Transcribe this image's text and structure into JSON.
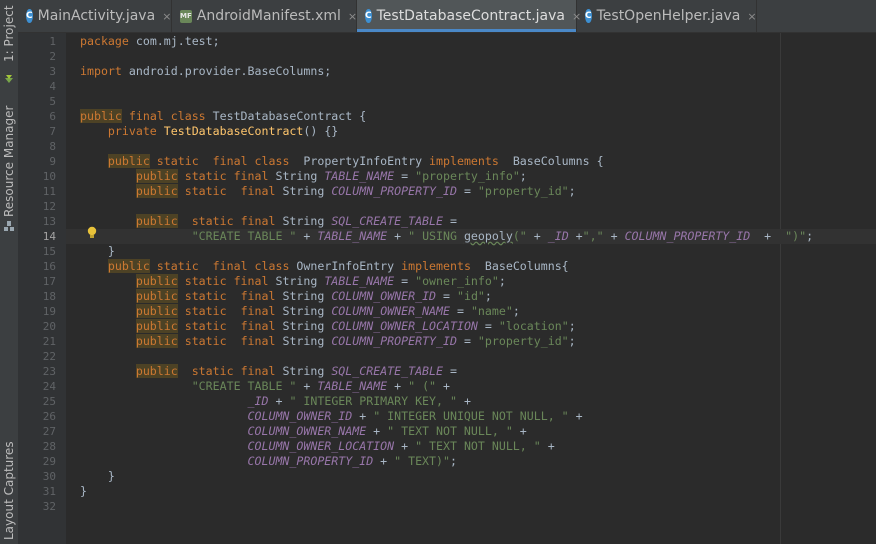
{
  "sidebar": {
    "project_label": "1: Project",
    "resource_label": "Resource Manager",
    "captures_label": "Layout Captures"
  },
  "tabs": [
    {
      "label": "MainActivity.java",
      "icon": "C",
      "type": "java",
      "active": false
    },
    {
      "label": "AndroidManifest.xml",
      "icon": "MF",
      "type": "xml",
      "active": false
    },
    {
      "label": "TestDatabaseContract.java",
      "icon": "C",
      "type": "java",
      "active": true
    },
    {
      "label": "TestOpenHelper.java",
      "icon": "C",
      "type": "java",
      "active": false
    }
  ],
  "close_glyph": "×",
  "editor": {
    "current_line": 14,
    "lines": [
      [
        [
          "kw",
          "package"
        ],
        [
          "p",
          " com.mj.test;"
        ]
      ],
      [],
      [
        [
          "kw",
          "import"
        ],
        [
          "p",
          " android.provider.BaseColumns;"
        ]
      ],
      [],
      [],
      [
        [
          "pub",
          "public"
        ],
        [
          "p",
          " "
        ],
        [
          "kw",
          "final class"
        ],
        [
          "p",
          " TestDatabaseContract {"
        ]
      ],
      [
        [
          "p",
          "    "
        ],
        [
          "kw",
          "private"
        ],
        [
          "p",
          " "
        ],
        [
          "fn",
          "TestDatabaseContract"
        ],
        [
          "p",
          "() {}"
        ]
      ],
      [],
      [
        [
          "p",
          "    "
        ],
        [
          "pub",
          "public"
        ],
        [
          "p",
          " "
        ],
        [
          "kw",
          "static"
        ],
        [
          "p",
          "  "
        ],
        [
          "kw",
          "final class"
        ],
        [
          "p",
          "  PropertyInfoEntry "
        ],
        [
          "kw",
          "implements"
        ],
        [
          "p",
          "  BaseColumns {"
        ]
      ],
      [
        [
          "p",
          "        "
        ],
        [
          "pub",
          "public"
        ],
        [
          "p",
          " "
        ],
        [
          "kw",
          "static final"
        ],
        [
          "p",
          " String "
        ],
        [
          "cst",
          "TABLE_NAME"
        ],
        [
          "p",
          " = "
        ],
        [
          "str",
          "\"property_info\""
        ],
        [
          "p",
          ";"
        ]
      ],
      [
        [
          "p",
          "        "
        ],
        [
          "pub",
          "public"
        ],
        [
          "p",
          " "
        ],
        [
          "kw",
          "static"
        ],
        [
          "p",
          "  "
        ],
        [
          "kw",
          "final"
        ],
        [
          "p",
          " String "
        ],
        [
          "cst",
          "COLUMN_PROPERTY_ID"
        ],
        [
          "p",
          " = "
        ],
        [
          "str",
          "\"property_id\""
        ],
        [
          "p",
          ";"
        ]
      ],
      [],
      [
        [
          "p",
          "        "
        ],
        [
          "pub",
          "public"
        ],
        [
          "p",
          "  "
        ],
        [
          "kw",
          "static final"
        ],
        [
          "p",
          " String "
        ],
        [
          "cst",
          "SQL_CREATE_TABLE"
        ],
        [
          "p",
          " ="
        ]
      ],
      [
        [
          "p",
          "                "
        ],
        [
          "str",
          "\"CREATE TABLE \""
        ],
        [
          "p",
          " + "
        ],
        [
          "cst",
          "TABLE_NAME"
        ],
        [
          "p",
          " + "
        ],
        [
          "str",
          "\" USING "
        ],
        [
          "warn",
          "geopoly"
        ],
        [
          "str",
          "(\""
        ],
        [
          "p",
          " + "
        ],
        [
          "cst",
          "_ID"
        ],
        [
          "p",
          " +"
        ],
        [
          "str",
          "\",\""
        ],
        [
          "p",
          " + "
        ],
        [
          "cst",
          "COLUMN_PROPERTY_ID"
        ],
        [
          "p",
          "  +  "
        ],
        [
          "str",
          "\")\""
        ],
        [
          "p",
          ";"
        ]
      ],
      [
        [
          "p",
          "    }"
        ]
      ],
      [
        [
          "p",
          "    "
        ],
        [
          "pub",
          "public"
        ],
        [
          "p",
          " "
        ],
        [
          "kw",
          "static"
        ],
        [
          "p",
          "  "
        ],
        [
          "kw",
          "final class"
        ],
        [
          "p",
          " OwnerInfoEntry "
        ],
        [
          "kw",
          "implements"
        ],
        [
          "p",
          "  BaseColumns{"
        ]
      ],
      [
        [
          "p",
          "        "
        ],
        [
          "pub",
          "public"
        ],
        [
          "p",
          " "
        ],
        [
          "kw",
          "static final"
        ],
        [
          "p",
          " String "
        ],
        [
          "cst",
          "TABLE_NAME"
        ],
        [
          "p",
          " = "
        ],
        [
          "str",
          "\"owner_info\""
        ],
        [
          "p",
          ";"
        ]
      ],
      [
        [
          "p",
          "        "
        ],
        [
          "pub",
          "public"
        ],
        [
          "p",
          " "
        ],
        [
          "kw",
          "static"
        ],
        [
          "p",
          "  "
        ],
        [
          "kw",
          "final"
        ],
        [
          "p",
          " String "
        ],
        [
          "cst",
          "COLUMN_OWNER_ID"
        ],
        [
          "p",
          " = "
        ],
        [
          "str",
          "\"id\""
        ],
        [
          "p",
          ";"
        ]
      ],
      [
        [
          "p",
          "        "
        ],
        [
          "pub",
          "public"
        ],
        [
          "p",
          " "
        ],
        [
          "kw",
          "static"
        ],
        [
          "p",
          "  "
        ],
        [
          "kw",
          "final"
        ],
        [
          "p",
          " String "
        ],
        [
          "cst",
          "COLUMN_OWNER_NAME"
        ],
        [
          "p",
          " = "
        ],
        [
          "str",
          "\"name\""
        ],
        [
          "p",
          ";"
        ]
      ],
      [
        [
          "p",
          "        "
        ],
        [
          "pub",
          "public"
        ],
        [
          "p",
          " "
        ],
        [
          "kw",
          "static"
        ],
        [
          "p",
          "  "
        ],
        [
          "kw",
          "final"
        ],
        [
          "p",
          " String "
        ],
        [
          "cst",
          "COLUMN_OWNER_LOCATION"
        ],
        [
          "p",
          " = "
        ],
        [
          "str",
          "\"location\""
        ],
        [
          "p",
          ";"
        ]
      ],
      [
        [
          "p",
          "        "
        ],
        [
          "pub",
          "public"
        ],
        [
          "p",
          " "
        ],
        [
          "kw",
          "static"
        ],
        [
          "p",
          "  "
        ],
        [
          "kw",
          "final"
        ],
        [
          "p",
          " String "
        ],
        [
          "cst",
          "COLUMN_PROPERTY_ID"
        ],
        [
          "p",
          " = "
        ],
        [
          "str",
          "\"property_id\""
        ],
        [
          "p",
          ";"
        ]
      ],
      [],
      [
        [
          "p",
          "        "
        ],
        [
          "pub",
          "public"
        ],
        [
          "p",
          "  "
        ],
        [
          "kw",
          "static final"
        ],
        [
          "p",
          " String "
        ],
        [
          "cst",
          "SQL_CREATE_TABLE"
        ],
        [
          "p",
          " ="
        ]
      ],
      [
        [
          "p",
          "                "
        ],
        [
          "str",
          "\"CREATE TABLE \""
        ],
        [
          "p",
          " + "
        ],
        [
          "cst",
          "TABLE_NAME"
        ],
        [
          "p",
          " + "
        ],
        [
          "str",
          "\" (\""
        ],
        [
          "p",
          " +"
        ]
      ],
      [
        [
          "p",
          "                        "
        ],
        [
          "cst",
          "_ID"
        ],
        [
          "p",
          " + "
        ],
        [
          "str",
          "\" INTEGER PRIMARY KEY, \""
        ],
        [
          "p",
          " +"
        ]
      ],
      [
        [
          "p",
          "                        "
        ],
        [
          "cst",
          "COLUMN_OWNER_ID"
        ],
        [
          "p",
          " + "
        ],
        [
          "str",
          "\" INTEGER UNIQUE NOT NULL, \""
        ],
        [
          "p",
          " +"
        ]
      ],
      [
        [
          "p",
          "                        "
        ],
        [
          "cst",
          "COLUMN_OWNER_NAME"
        ],
        [
          "p",
          " + "
        ],
        [
          "str",
          "\" TEXT NOT NULL, \""
        ],
        [
          "p",
          " +"
        ]
      ],
      [
        [
          "p",
          "                        "
        ],
        [
          "cst",
          "COLUMN_OWNER_LOCATION"
        ],
        [
          "p",
          " + "
        ],
        [
          "str",
          "\" TEXT NOT NULL, \""
        ],
        [
          "p",
          " +"
        ]
      ],
      [
        [
          "p",
          "                        "
        ],
        [
          "cst",
          "COLUMN_PROPERTY_ID"
        ],
        [
          "p",
          " + "
        ],
        [
          "str",
          "\" TEXT)\""
        ],
        [
          "p",
          ";"
        ]
      ],
      [
        [
          "p",
          "    }"
        ]
      ],
      [
        [
          "p",
          "}"
        ]
      ],
      []
    ]
  },
  "colors": {
    "keyword": "#cc7832",
    "string": "#6a8759",
    "constant": "#9876aa",
    "method": "#ffc66d",
    "text": "#a9b7c6",
    "background": "#2b2b2b",
    "accent": "#4a88c7"
  }
}
